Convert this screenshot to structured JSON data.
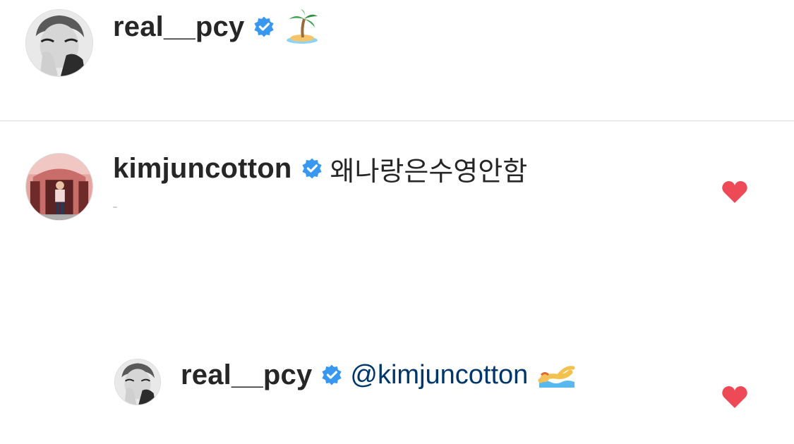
{
  "comments": [
    {
      "username": "real__pcy",
      "verified": true,
      "text": "",
      "emoji": "desert-island-emoji",
      "avatar": "real-pcy-avatar"
    },
    {
      "username": "kimjuncotton",
      "verified": true,
      "text": "왜나랑은수영안함",
      "liked": true,
      "avatar": "kimjuncotton-avatar",
      "replies": [
        {
          "username": "real__pcy",
          "verified": true,
          "mention": "@kimjuncotton",
          "emoji": "swimmer-emoji",
          "liked": true,
          "avatar": "real-pcy-avatar"
        }
      ]
    }
  ],
  "colors": {
    "username": "#262626",
    "mention": "#00376b",
    "verified_badge": "#3897f0",
    "heart_liked": "#ed4956",
    "divider": "#dbdbdb"
  }
}
